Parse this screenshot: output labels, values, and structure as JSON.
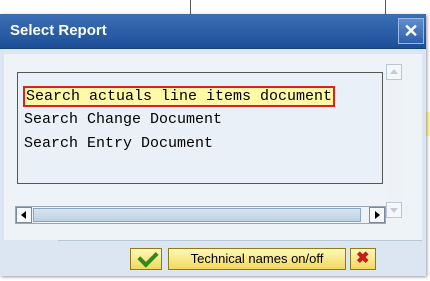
{
  "dialog": {
    "title": "Select Report",
    "close_glyph": "✕",
    "list_items": [
      {
        "label": "Search actuals line items document",
        "selected": true
      },
      {
        "label": "Search Change Document",
        "selected": false
      },
      {
        "label": "Search Entry Document",
        "selected": false
      }
    ],
    "buttons": {
      "technical_names": "Technical names on/off",
      "cancel_glyph": "✖"
    },
    "icons": {
      "ok": "check-icon",
      "cancel": "cancel-icon"
    },
    "colors": {
      "titlebar": "#2d5fab",
      "selection_fill": "#fff8a6",
      "selection_border": "#e02020",
      "button": "#f1d85e"
    }
  }
}
